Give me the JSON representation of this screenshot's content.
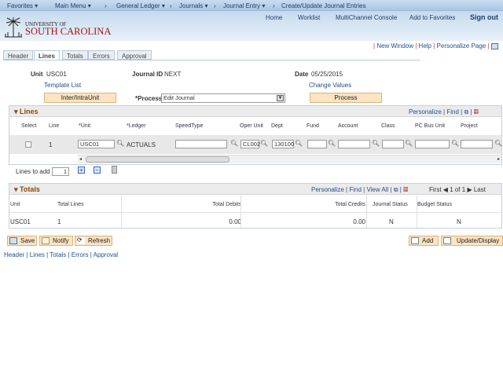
{
  "nav": {
    "favorites": "Favorites",
    "main_menu": "Main Menu",
    "general_ledger": "General Ledger",
    "journals": "Journals",
    "journal_entry": "Journal Entry",
    "current": "Create/Update Journal Entries"
  },
  "header": {
    "logo_line1": "UNIVERSITY OF",
    "logo_line2": "SOUTH CAROLINA",
    "home": "Home",
    "worklist": "Worklist",
    "multichannel": "MultiChannel Console",
    "add_favorites": "Add to Favorites",
    "sign_out": "Sign out"
  },
  "pagelinks": {
    "new_window": "New Window",
    "help": "Help",
    "personalize_page": "Personalize Page"
  },
  "tabs": [
    {
      "label": "Header"
    },
    {
      "label": "Lines"
    },
    {
      "label": "Totals"
    },
    {
      "label": "Errors"
    },
    {
      "label": "Approval"
    }
  ],
  "form": {
    "unit_label": "Unit",
    "unit": "USC01",
    "journal_id_label": "Journal ID",
    "journal_id": "NEXT",
    "date_label": "Date",
    "date": "05/25/2015",
    "template_list": "Template List",
    "change_values": "Change Values",
    "inter_intra": "Inter/IntraUnit",
    "process_label": "*Process",
    "process_value": "Edit Journal",
    "process_button": "Process"
  },
  "lines": {
    "title": "Lines",
    "personalize": "Personalize",
    "find": "Find",
    "columns": [
      "Select",
      "Line",
      "*Unit",
      "*Ledger",
      "SpeedType",
      "Oper Unit",
      "Dept",
      "Fund",
      "Account",
      "Class",
      "PC Bus Unit",
      "Project"
    ],
    "row": {
      "line": "1",
      "unit": "USC01",
      "ledger": "ACTUALS",
      "speedtype": "",
      "oper_unit": "CL002",
      "dept": "130100",
      "fund": "",
      "account": "",
      "class": "",
      "pc_bus_unit": "",
      "project": ""
    },
    "lines_to_add_label": "Lines to add",
    "lines_to_add": "1"
  },
  "totals": {
    "title": "Totals",
    "personalize": "Personalize",
    "find": "Find",
    "view_all": "View All",
    "first": "First",
    "pager": "1 of 1",
    "last": "Last",
    "columns": [
      "Unit",
      "Total Lines",
      "Total Debits",
      "Total Credits",
      "Journal Status",
      "Budget Status"
    ],
    "row": {
      "unit": "USC01",
      "total_lines": "1",
      "total_debits": "0.00",
      "total_credits": "0.00",
      "journal_status": "N",
      "budget_status": "N"
    }
  },
  "buttons": {
    "save": "Save",
    "notify": "Notify",
    "refresh": "Refresh",
    "add": "Add",
    "update_display": "Update/Display"
  },
  "footer_links": [
    "Header",
    "Lines",
    "Totals",
    "Errors",
    "Approval"
  ]
}
